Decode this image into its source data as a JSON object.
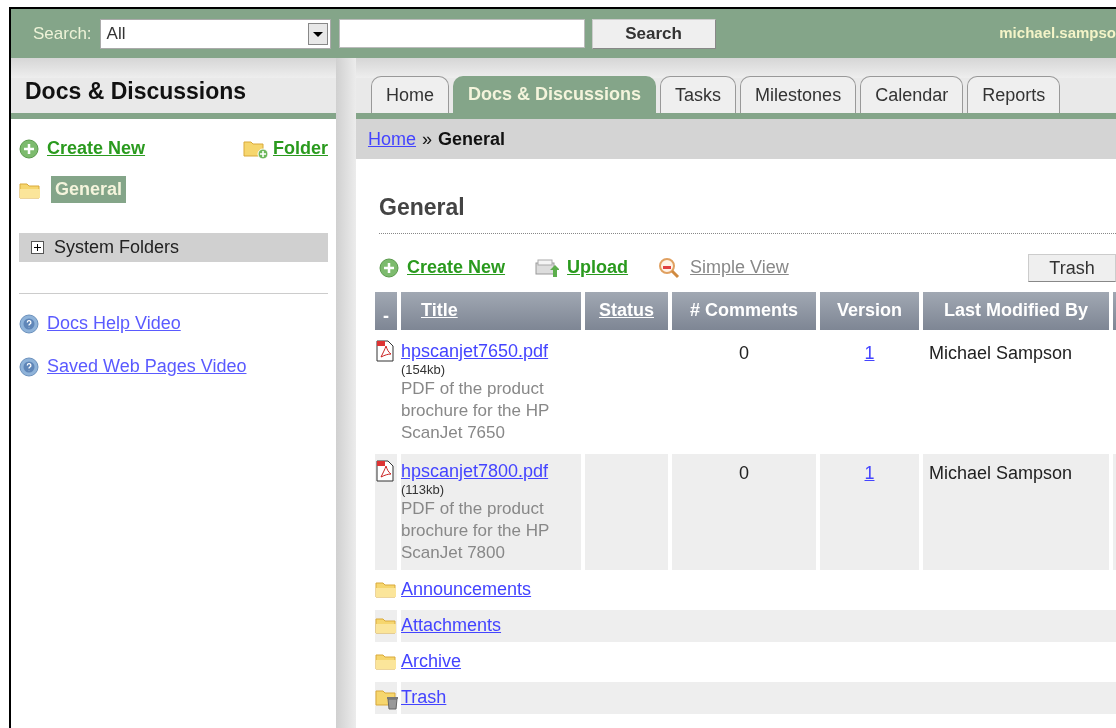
{
  "header": {
    "search_label": "Search:",
    "scope_select": {
      "value": "All"
    },
    "search_button": "Search",
    "user": "michael.sampso"
  },
  "sidebar": {
    "title": "Docs & Discussions",
    "create_new": "Create New",
    "folder": "Folder",
    "folders": [
      {
        "label": "General",
        "selected": true
      }
    ],
    "system_folders": {
      "label": "System Folders",
      "expanded": false
    },
    "help_links": [
      "Docs Help Video",
      "Saved Web Pages Video"
    ]
  },
  "tabs": [
    {
      "label": "Home",
      "selected": false
    },
    {
      "label": "Docs & Discussions",
      "selected": true
    },
    {
      "label": "Tasks",
      "selected": false
    },
    {
      "label": "Milestones",
      "selected": false
    },
    {
      "label": "Calendar",
      "selected": false
    },
    {
      "label": "Reports",
      "selected": false
    }
  ],
  "breadcrumb": {
    "link": "Home",
    "separator": "»",
    "current": "General"
  },
  "content": {
    "heading": "General",
    "actions": [
      {
        "kind": "create",
        "label": "Create New"
      },
      {
        "kind": "upload",
        "label": "Upload"
      },
      {
        "kind": "view",
        "label": "Simple View"
      }
    ],
    "trash_button": "Trash"
  },
  "table": {
    "columns": [
      {
        "label": "-",
        "sortable": false
      },
      {
        "label": "Title",
        "sortable": true
      },
      {
        "label": "Status",
        "sortable": true
      },
      {
        "label": "# Comments",
        "sortable": false
      },
      {
        "label": "Version",
        "sortable": false
      },
      {
        "label": "Last Modified By",
        "sortable": false
      }
    ],
    "rows": [
      {
        "kind": "file",
        "name": "hpscanjet7650.pdf",
        "size": "(154kb)",
        "description": "PDF of the product brochure for the HP ScanJet 7650",
        "comments": "0",
        "version": "1",
        "modified_by": "Michael Sampson"
      },
      {
        "kind": "file",
        "name": "hpscanjet7800.pdf",
        "size": "(113kb)",
        "description": "PDF of the product brochure for the HP ScanJet 7800",
        "comments": "0",
        "version": "1",
        "modified_by": "Michael Sampson"
      },
      {
        "kind": "folder",
        "name": "Announcements"
      },
      {
        "kind": "folder",
        "name": "Attachments"
      },
      {
        "kind": "folder",
        "name": "Archive"
      },
      {
        "kind": "trash",
        "name": "Trash"
      }
    ]
  }
}
